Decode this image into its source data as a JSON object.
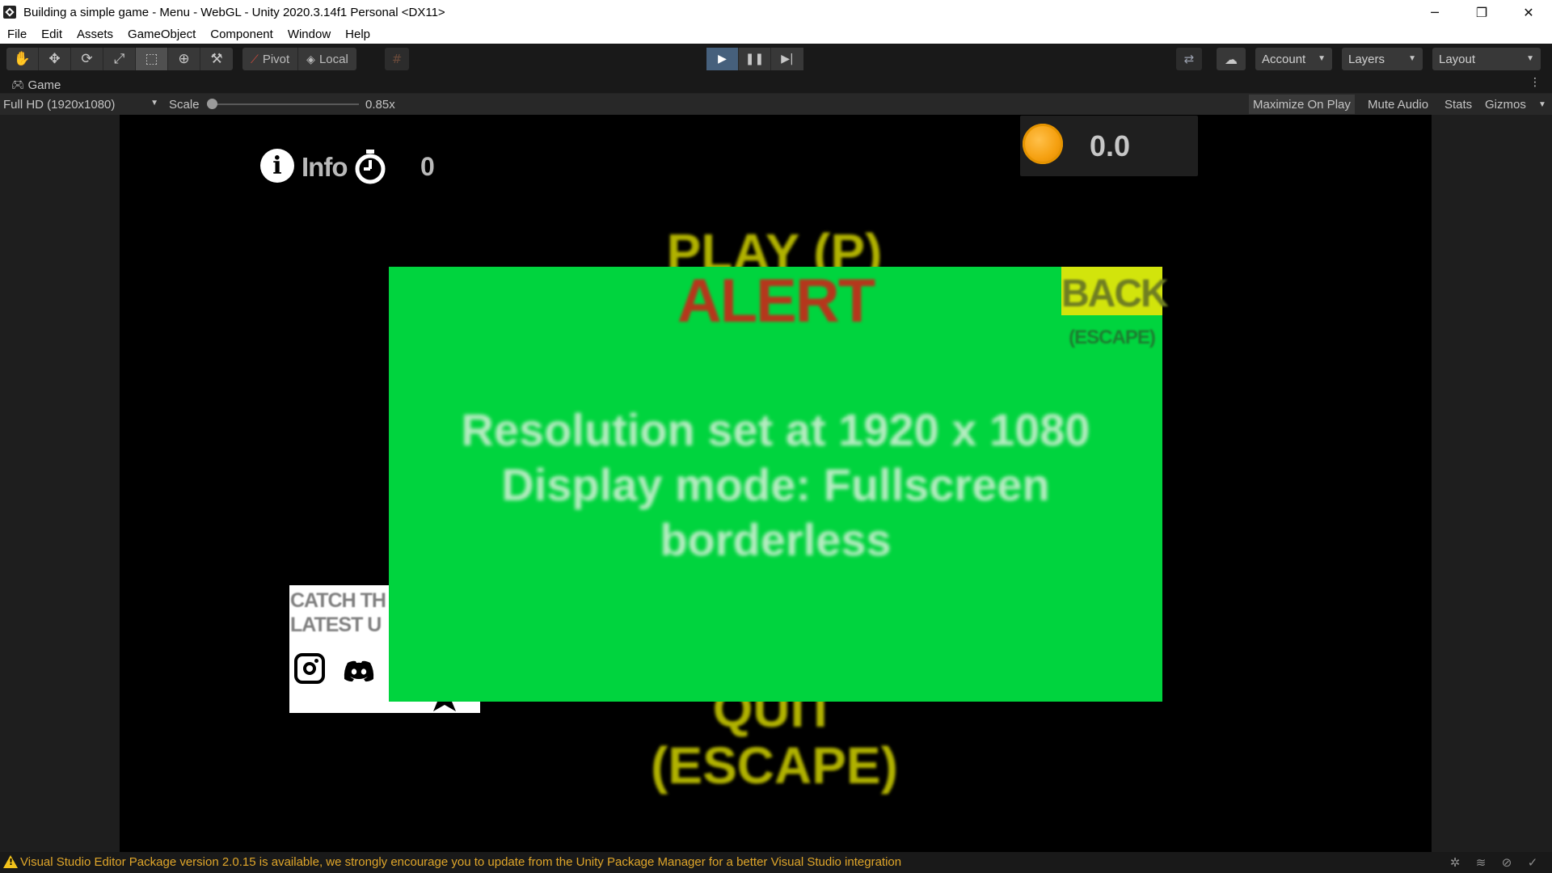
{
  "window": {
    "title": "Building a simple game - Menu - WebGL - Unity 2020.3.14f1 Personal <DX11>",
    "controls": {
      "minimize": "─",
      "restore": "❐",
      "close": "✕"
    }
  },
  "menu": {
    "items": [
      {
        "label": "File"
      },
      {
        "label": "Edit"
      },
      {
        "label": "Assets"
      },
      {
        "label": "GameObject"
      },
      {
        "label": "Component"
      },
      {
        "label": "Window"
      },
      {
        "label": "Help"
      }
    ]
  },
  "toolbar": {
    "tools": [
      {
        "icon": "hand-tool-icon",
        "glyph": "✋"
      },
      {
        "icon": "move-tool-icon",
        "glyph": "✥"
      },
      {
        "icon": "rotate-tool-icon",
        "glyph": "⟳"
      },
      {
        "icon": "scale-tool-icon",
        "glyph": "⤢"
      },
      {
        "icon": "rect-tool-icon",
        "glyph": "⬚"
      },
      {
        "icon": "transform-tool-icon",
        "glyph": "⊕"
      },
      {
        "icon": "custom-tool-icon",
        "glyph": "⚒"
      }
    ],
    "pivot_label": "Pivot",
    "local_label": "Local",
    "account_label": "Account",
    "layers_label": "Layers",
    "layout_label": "Layout"
  },
  "tab": {
    "label": "Game"
  },
  "game_toolbar": {
    "resolution": "Full HD (1920x1080)",
    "scale_label": "Scale",
    "scale_value": "0.85x",
    "scale_fraction": 0.0,
    "maximize_label": "Maximize On Play",
    "mute_label": "Mute Audio",
    "stats_label": "Stats",
    "gizmos_label": "Gizmos"
  },
  "game": {
    "info_label": "Info",
    "timer_value": "0",
    "coins_value": "0.0",
    "play_label": "PLAY (P)",
    "quit_label": "QUIT",
    "quit_hint": "(ESCAPE)",
    "social_line1": "CATCH TH",
    "social_line2": "LATEST U",
    "alert": {
      "title": "ALERT",
      "back_label": "BACK",
      "back_hint": "(ESCAPE)",
      "line1": "Resolution set at 1920 x 1080",
      "line2": "Display mode: Fullscreen",
      "line3": "borderless"
    },
    "colors": {
      "panel": "#00d43e",
      "alert_title": "#b5371c",
      "back_button": "#d2e40c",
      "menu_text": "#b1b200",
      "coin": "#f5a010"
    }
  },
  "status": {
    "message": "Visual Studio Editor Package version 2.0.15 is available, we strongly encourage you to update from the Unity Package Manager for a better Visual Studio integration",
    "icons": [
      "bug-icon",
      "layers-icon",
      "network-icon",
      "check-circle-icon"
    ]
  }
}
